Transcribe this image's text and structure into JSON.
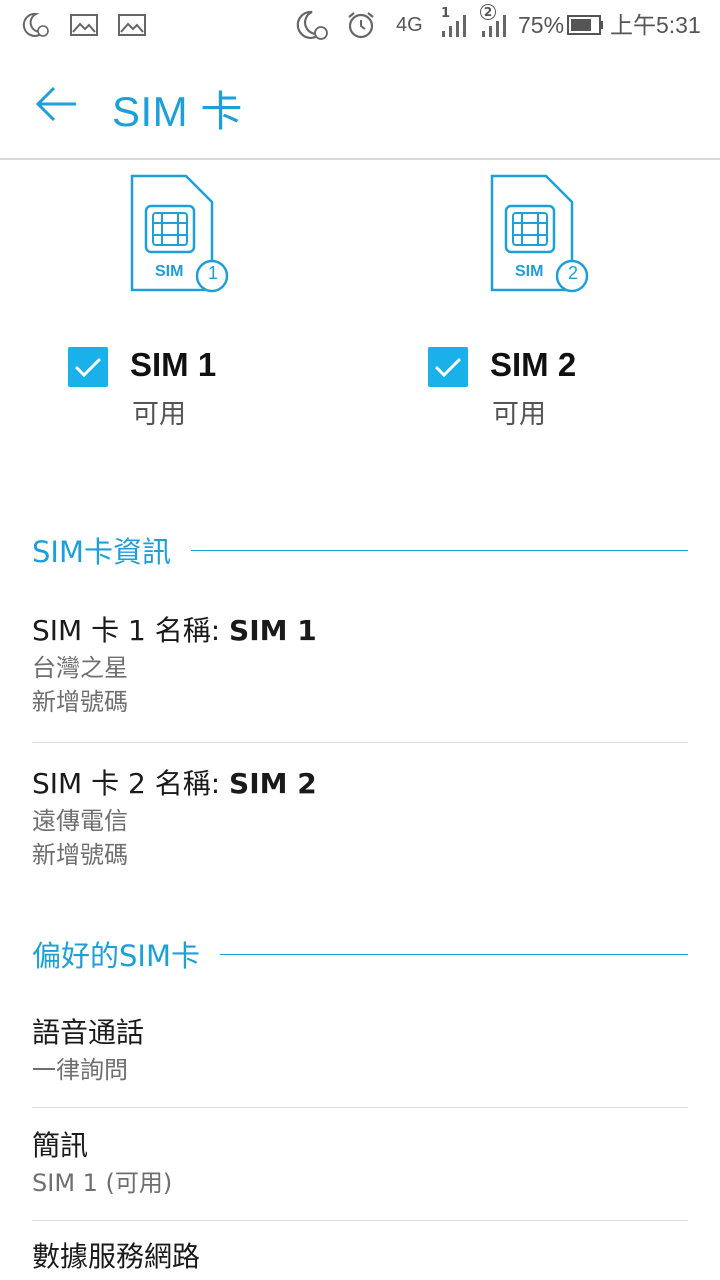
{
  "status_bar": {
    "network_type": "4G",
    "sim1_slot": "1",
    "sim2_slot": "2",
    "battery_percent": "75%",
    "time": "上午5:31",
    "icons": [
      "moon-alarm-icon",
      "image-icon",
      "image-icon",
      "moon-alarm-icon",
      "alarm-clock-icon",
      "signal-icon",
      "signal-icon",
      "battery-icon"
    ]
  },
  "app_bar": {
    "title": "SIM 卡",
    "back_icon": "arrow-left-icon"
  },
  "sims": [
    {
      "icon_label": "SIM",
      "slot": "1",
      "name": "SIM 1",
      "status": "可用",
      "checked": true
    },
    {
      "icon_label": "SIM",
      "slot": "2",
      "name": "SIM 2",
      "status": "可用",
      "checked": true
    }
  ],
  "sim_info": {
    "header": "SIM卡資訊",
    "items": [
      {
        "title_prefix": "SIM 卡 1 名稱: ",
        "title_value": "SIM 1",
        "carrier": "台灣之星",
        "action": "新增號碼"
      },
      {
        "title_prefix": "SIM 卡 2 名稱: ",
        "title_value": "SIM 2",
        "carrier": "遠傳電信",
        "action": "新增號碼"
      }
    ]
  },
  "preferred": {
    "header": "偏好的SIM卡",
    "items": [
      {
        "title": "語音通話",
        "value": "一律詢問"
      },
      {
        "title": "簡訊",
        "value": "SIM 1 (可用)"
      },
      {
        "title": "數據服務網路"
      }
    ]
  },
  "colors": {
    "accent": "#1e9fd8",
    "checkbox": "#1ab0ea",
    "divider": "#dcdcdc"
  }
}
